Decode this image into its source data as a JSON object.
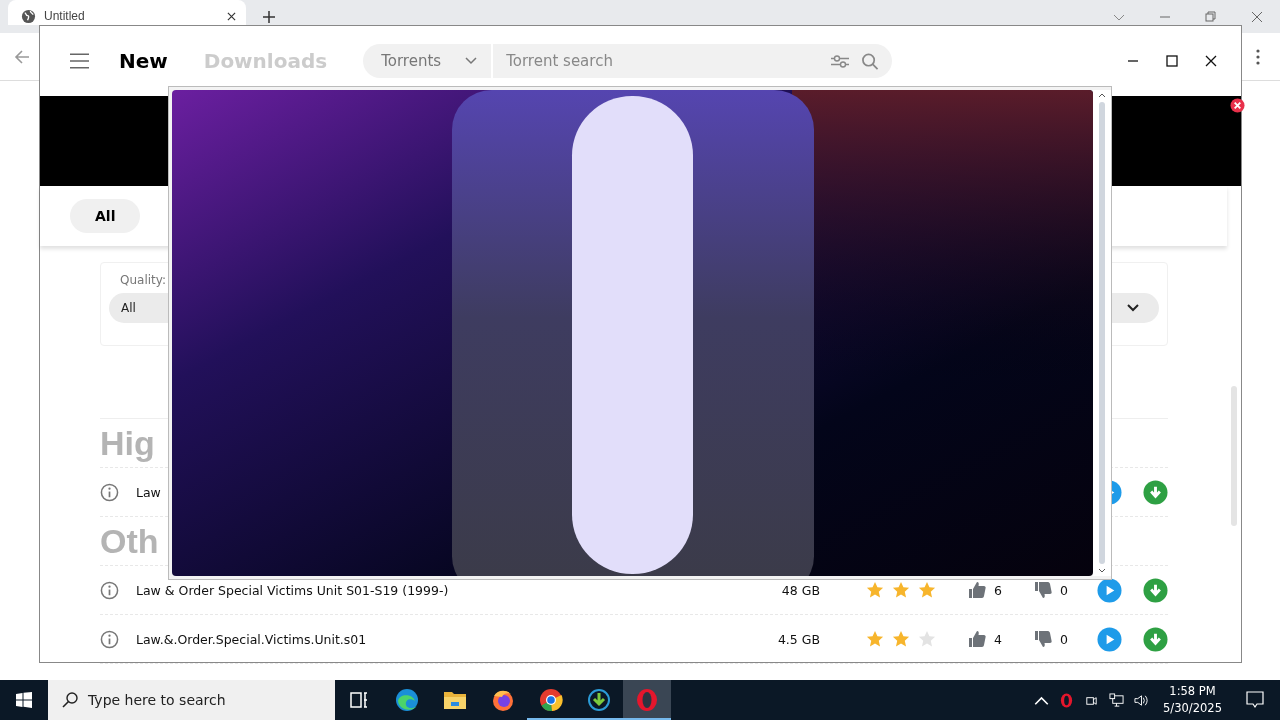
{
  "browser": {
    "tab_title": "Untitled"
  },
  "app": {
    "nav": [
      {
        "label": "New",
        "selected": true
      },
      {
        "label": "Downloads",
        "selected": false
      }
    ],
    "search": {
      "category": "Torrents",
      "placeholder": "Torrent search"
    },
    "chips": [
      {
        "label": "All",
        "selected": true
      }
    ],
    "filter": {
      "label": "Quality:",
      "value": "All"
    },
    "sections": [
      {
        "heading": "Hig",
        "rows": [
          {
            "name": "Law"
          }
        ]
      },
      {
        "heading": "Oth",
        "rows": [
          {
            "name": "Law & Order Special Victims Unit S01-S19 (1999-)",
            "size": "48 GB",
            "stars": 3,
            "likes": "6",
            "dislikes": "0"
          },
          {
            "name": "Law.&.Order.Special.Victims.Unit.s01",
            "size": "4.5 GB",
            "stars": 2,
            "likes": "4",
            "dislikes": "0"
          }
        ]
      }
    ]
  },
  "taskbar": {
    "search_placeholder": "Type here to search",
    "apps": [
      {
        "kind": "task-view",
        "running": false,
        "selected": false
      },
      {
        "kind": "edge",
        "running": false,
        "selected": false
      },
      {
        "kind": "explorer",
        "running": false,
        "selected": false
      },
      {
        "kind": "firefox",
        "running": false,
        "selected": false
      },
      {
        "kind": "chrome",
        "running": true,
        "selected": false
      },
      {
        "kind": "downloader",
        "running": true,
        "selected": false
      },
      {
        "kind": "opera",
        "running": true,
        "selected": true
      }
    ],
    "time": "1:58 PM",
    "date": "5/30/2025"
  }
}
